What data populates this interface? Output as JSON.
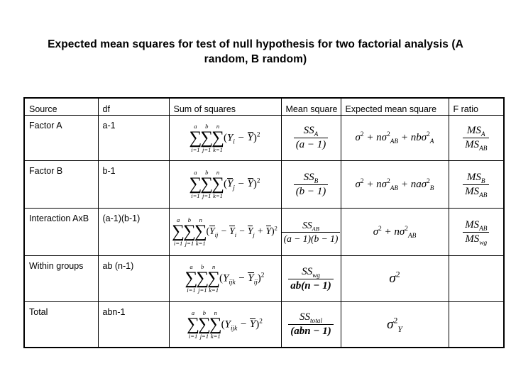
{
  "title": "Expected mean squares for test of null hypothesis for two factorial analysis (A random, B random)",
  "table": {
    "headers": {
      "source": "Source",
      "df": "df",
      "sum_of_squares": "Sum of squares",
      "mean_square": "Mean square",
      "expected_mean_square": "Expected mean square",
      "f_ratio": "F ratio"
    },
    "rows": [
      {
        "source": "Factor A",
        "df": "a-1",
        "sum_of_squares": "sum(i=1..a) sum(j=1..b) sum(k=1..n) (Y_i - Ybar)^2",
        "mean_square_num": "SS_A",
        "mean_square_den": "(a - 1)",
        "expected_mean_square": "sigma^2 + n*sigma^2_AB + nb*sigma^2_A",
        "f_ratio_num": "MS_A",
        "f_ratio_den": "MS_AB"
      },
      {
        "source": "Factor B",
        "df": "b-1",
        "sum_of_squares": "sum(i=1..a) sum(j=1..b) sum(k=1..n) (Ybar_j - Ybar)^2",
        "mean_square_num": "SS_B",
        "mean_square_den": "(b - 1)",
        "expected_mean_square": "sigma^2 + n*sigma^2_AB + na*sigma^2_B",
        "f_ratio_num": "MS_B",
        "f_ratio_den": "MS_AB"
      },
      {
        "source": "Interaction AxB",
        "df": "(a-1)(b-1)",
        "sum_of_squares": "sum(i=1..a) sum(j=1..b) sum(k=1..n) (Ybar_ij - Ybar_i - Ybar_j + Ybar)^2",
        "mean_square_num": "SS_AB",
        "mean_square_den": "(a - 1)(b - 1)",
        "expected_mean_square": "sigma^2 + n*sigma^2_AB",
        "f_ratio_num": "MS_AB",
        "f_ratio_den": "MS_wg"
      },
      {
        "source": "Within groups",
        "df": "ab (n-1)",
        "sum_of_squares": "sum(i=1..a) sum(j=1..b) sum(k=1..n) (Y_ijk - Ybar_ij)^2",
        "mean_square_num": "SS_wg",
        "mean_square_den": "ab(n - 1)",
        "expected_mean_square": "sigma^2",
        "f_ratio_num": "",
        "f_ratio_den": ""
      },
      {
        "source": "Total",
        "df": "abn-1",
        "sum_of_squares": "sum(i=1..a) sum(j=1..b) sum(k=1..n) (Y_ijk - Ybar)^2",
        "mean_square_num": "SS_total",
        "mean_square_den": "(abn - 1)",
        "expected_mean_square": "sigma^2_Y",
        "f_ratio_num": "",
        "f_ratio_den": ""
      }
    ],
    "symbols": {
      "sigma": "σ",
      "sum": "∑",
      "limit_a": "a",
      "limit_b": "b",
      "limit_n": "n",
      "index_i": "i=1",
      "index_j": "j=1",
      "index_k": "k=1"
    }
  },
  "colors": {
    "text": "#000000",
    "background": "#ffffff",
    "border": "#000000"
  }
}
